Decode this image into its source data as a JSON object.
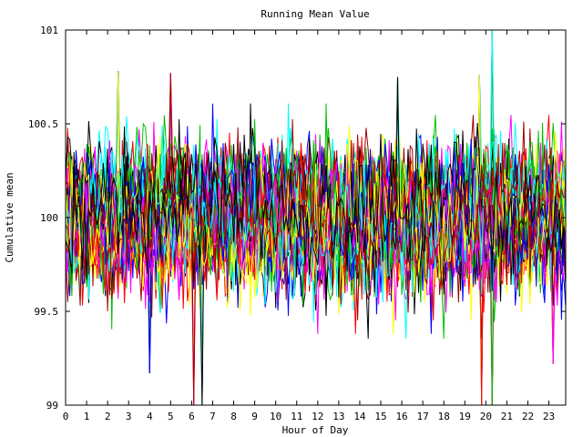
{
  "chart_data": {
    "type": "line",
    "title": "Running Mean Value",
    "xlabel": "Hour of Day",
    "ylabel": "Cumulative mean",
    "xlim": [
      0,
      23.8
    ],
    "ylim": [
      99,
      101
    ],
    "x_ticks": [
      0,
      1,
      2,
      3,
      4,
      5,
      6,
      7,
      8,
      9,
      10,
      11,
      12,
      13,
      14,
      15,
      16,
      17,
      18,
      19,
      20,
      21,
      22,
      23
    ],
    "y_ticks": [
      99,
      99.5,
      100,
      100.5,
      101
    ],
    "x_tick_labels": [
      "0",
      "1",
      "2",
      "3",
      "4",
      "5",
      "6",
      "7",
      "8",
      "9",
      "10",
      "11",
      "12",
      "13",
      "14",
      "15",
      "16",
      "17",
      "18",
      "19",
      "20",
      "21",
      "22",
      "23"
    ],
    "y_tick_labels": [
      "99",
      "99.5",
      "100",
      "100.5",
      "101"
    ],
    "grid": false,
    "legend": "none",
    "series_count": 48,
    "colors": [
      "#ff0000",
      "#00c000",
      "#0000ff",
      "#ff00ff",
      "#00ffff",
      "#ffff00",
      "#a00000",
      "#000000"
    ],
    "sample_step_hours": 0.1,
    "center": 100,
    "typical_spread": 0.2,
    "notable_extremes": [
      {
        "x": 20.3,
        "y": 101.0
      },
      {
        "x": 2.5,
        "y": 100.78
      },
      {
        "x": 5.0,
        "y": 100.77
      },
      {
        "x": 15.8,
        "y": 100.75
      },
      {
        "x": 19.7,
        "y": 100.76
      },
      {
        "x": 6.1,
        "y": 99.0
      },
      {
        "x": 6.5,
        "y": 99.0
      },
      {
        "x": 19.8,
        "y": 99.0
      },
      {
        "x": 20.3,
        "y": 99.0
      },
      {
        "x": 4.0,
        "y": 99.17
      },
      {
        "x": 23.2,
        "y": 99.22
      }
    ]
  }
}
